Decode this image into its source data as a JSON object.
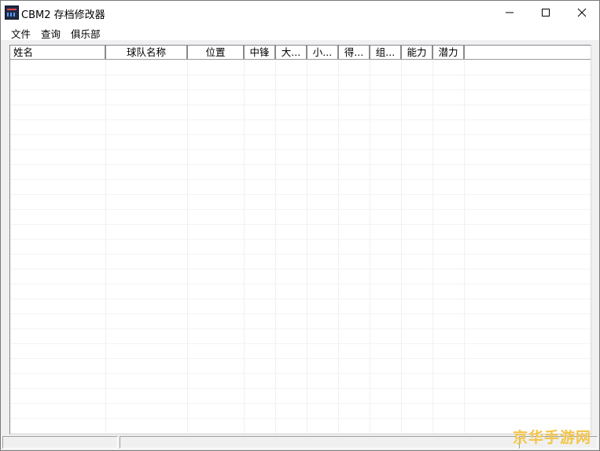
{
  "window": {
    "title": "CBM2 存档修改器",
    "icon": "app-icon"
  },
  "menu": [
    "文件",
    "查询",
    "俱乐部"
  ],
  "table": {
    "columns": [
      "姓名",
      "球队名称",
      "位置",
      "中锋",
      "大...",
      "小...",
      "得...",
      "组...",
      "能力",
      "潜力"
    ],
    "rows": []
  },
  "statusbar": {
    "panes": [
      "",
      "",
      ""
    ]
  },
  "watermark": "京华手游网",
  "colors": {
    "watermark": "#f3c54a",
    "window_bg": "#f0f0f0"
  }
}
